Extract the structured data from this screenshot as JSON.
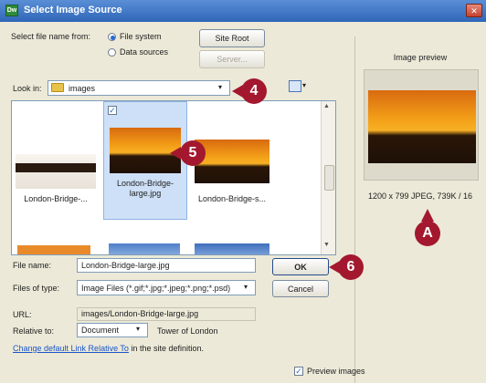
{
  "title": "Select Image Source",
  "close_glyph": "✕",
  "select_from": {
    "label": "Select file name from:",
    "options": [
      "File system",
      "Data sources"
    ],
    "selected": "File system"
  },
  "buttons": {
    "site_root": "Site Root",
    "server": "Server...",
    "ok": "OK",
    "cancel": "Cancel"
  },
  "look_in": {
    "label": "Look in:",
    "value": "images"
  },
  "files": [
    {
      "name": "London-Bridge-...",
      "selected": false
    },
    {
      "name": "London-Bridge-large.jpg",
      "selected": true
    },
    {
      "name": "London-Bridge-s...",
      "selected": false
    }
  ],
  "file_name": {
    "label": "File name:",
    "value": "London-Bridge-large.jpg"
  },
  "files_of_type": {
    "label": "Files of type:",
    "value": "Image Files (*.gif;*.jpg;*.jpeg;*.png;*.psd)"
  },
  "url": {
    "label": "URL:",
    "value": "images/London-Bridge-large.jpg"
  },
  "relative_to": {
    "label": "Relative to:",
    "value": "Document",
    "note": "Tower of London"
  },
  "change_link": {
    "link": "Change default Link Relative To",
    "suffix": "in the site definition."
  },
  "preview": {
    "label": "Image preview",
    "info": "1200 x 799 JPEG, 739K / 16",
    "checkbox_label": "Preview images",
    "checked": true
  },
  "callouts": {
    "look_in": "4",
    "thumb": "5",
    "ok": "6",
    "preview": "A"
  },
  "colors": {
    "callout": "#a3182e",
    "titlebar": "#2f66b8"
  }
}
